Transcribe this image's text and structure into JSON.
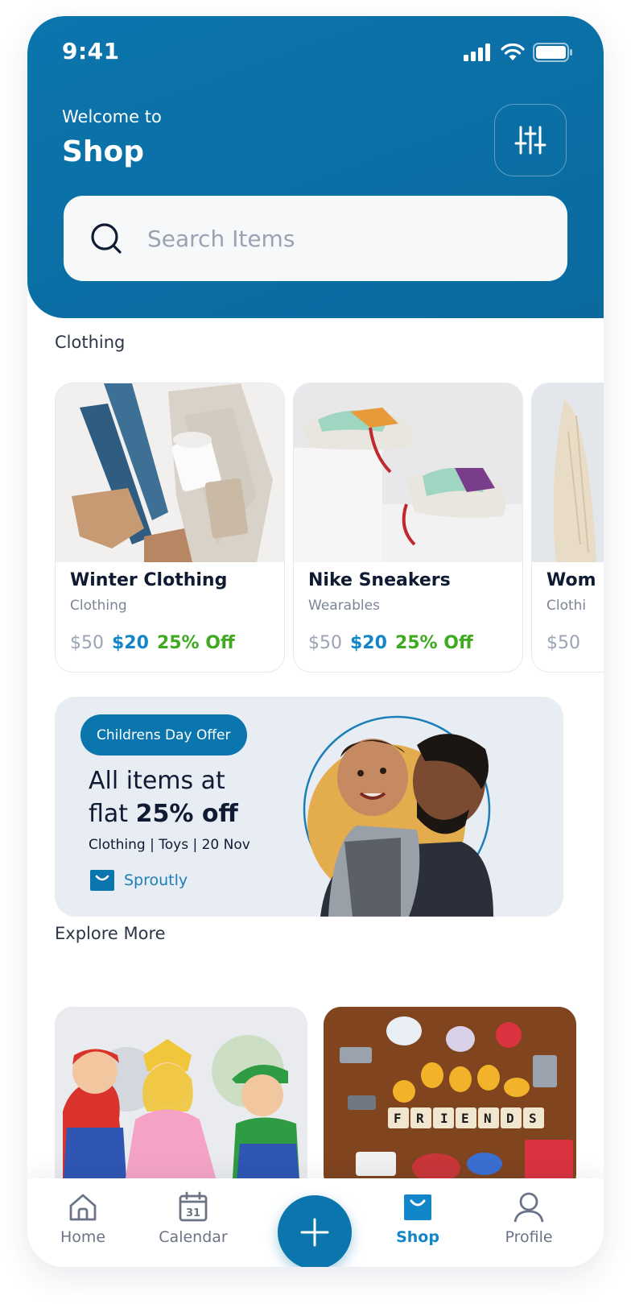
{
  "status_bar": {
    "time": "9:41"
  },
  "header": {
    "welcome": "Welcome to",
    "title": "Shop",
    "search_placeholder": "Search Items"
  },
  "sections": {
    "clothing": "Clothing",
    "explore": "Explore More"
  },
  "products": [
    {
      "name": "Winter Clothing",
      "category": "Clothing",
      "old_price": "$50",
      "new_price": "$20",
      "discount": "25% Off"
    },
    {
      "name": "Nike Sneakers",
      "category": "Wearables",
      "old_price": "$50",
      "new_price": "$20",
      "discount": "25% Off"
    },
    {
      "name": "Wom",
      "category": "Clothi",
      "old_price": "$50",
      "new_price": "",
      "discount": ""
    }
  ],
  "promo": {
    "pill": "Childrens Day Offer",
    "line1": "All items at",
    "line2_prefix": "flat ",
    "line2_bold": "25% off",
    "subtitle": "Clothing | Toys | 20 Nov",
    "brand": "Sproutly"
  },
  "nav": {
    "items": [
      {
        "label": "Home",
        "icon": "home-icon"
      },
      {
        "label": "Calendar",
        "icon": "calendar-icon",
        "day": "31"
      },
      {
        "label": "Shop",
        "icon": "shop-bag-icon",
        "active": true
      },
      {
        "label": "Profile",
        "icon": "profile-icon"
      }
    ],
    "fab_icon": "plus-icon"
  },
  "colors": {
    "primary": "#0b75ad",
    "price_new": "#1286c8",
    "discount": "#3faa1f",
    "promo_bg": "#e8ecf3"
  }
}
